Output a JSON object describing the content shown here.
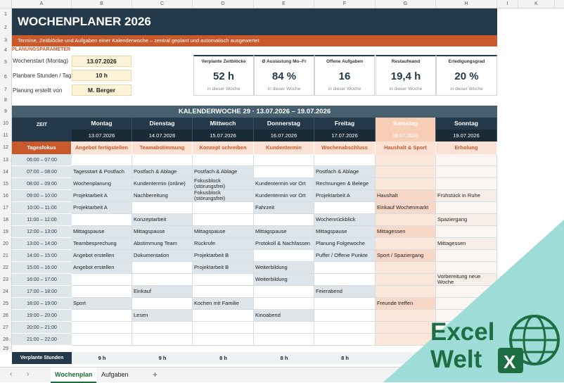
{
  "columns": [
    "A",
    "B",
    "C",
    "D",
    "E",
    "F",
    "G",
    "H",
    "I",
    "K"
  ],
  "rows": [
    "1",
    "2",
    "3",
    "4",
    "5",
    "6",
    "7",
    "8",
    "9",
    "10",
    "11",
    "12",
    "13",
    "14",
    "15",
    "16",
    "17",
    "18",
    "19",
    "20",
    "21",
    "22",
    "23",
    "24",
    "25",
    "26",
    "27",
    "28",
    "29"
  ],
  "title": "WOCHENPLANER 2026",
  "subtitle": "Termine, Zeitblöcke und Aufgaben einer Kalenderwoche – zentral geplant und automatisch ausgewertet",
  "params": {
    "header": "PLANUNGSPARAMETER",
    "items": [
      {
        "label": "Wochenstart (Montag)",
        "value": "13.07.2026"
      },
      {
        "label": "Planbare Stunden / Tag",
        "value": "10 h"
      },
      {
        "label": "Planung erstellt von",
        "value": "M. Berger"
      }
    ]
  },
  "kpis": [
    {
      "label": "Verplante Zeitblöcke",
      "value": "52 h",
      "sub": "in dieser Woche"
    },
    {
      "label": "Ø Auslastung Mo–Fr",
      "value": "84 %",
      "sub": "in dieser Woche"
    },
    {
      "label": "Offene Aufgaben",
      "value": "16",
      "sub": "in dieser Woche"
    },
    {
      "label": "Restaufwand",
      "value": "19,4 h",
      "sub": "in dieser Woche"
    },
    {
      "label": "Erledigungsgrad",
      "value": "20 %",
      "sub": "in dieser Woche"
    }
  ],
  "kw_title": "KALENDERWOCHE 29   ·   13.07.2026 – 19.07.2026",
  "zeit_label": "ZEIT",
  "days": [
    {
      "name": "Montag",
      "date": "13.07.2026",
      "focus": "Angebot fertigstellen"
    },
    {
      "name": "Dienstag",
      "date": "14.07.2026",
      "focus": "Teamabstimmung"
    },
    {
      "name": "Mittwoch",
      "date": "15.07.2026",
      "focus": "Konzept schreiben"
    },
    {
      "name": "Donnerstag",
      "date": "16.07.2026",
      "focus": "Kundentermin"
    },
    {
      "name": "Freitag",
      "date": "17.07.2026",
      "focus": "Wochenabschluss"
    },
    {
      "name": "Samstag",
      "date": "18.07.2026",
      "focus": "Haushalt & Sport"
    },
    {
      "name": "Sonntag",
      "date": "19.07.2026",
      "focus": "Erholung"
    }
  ],
  "focus_label": "Tagesfokus",
  "slots": [
    {
      "time": "06:00 – 07:00",
      "cells": [
        "",
        "",
        "",
        "",
        "",
        "",
        ""
      ]
    },
    {
      "time": "07:00 – 08:00",
      "cells": [
        "Tagesstart & Postfach",
        "Postfach & Ablage",
        "Postfach & Ablage",
        "",
        "Postfach & Ablage",
        "",
        ""
      ]
    },
    {
      "time": "08:00 – 09:00",
      "cells": [
        "Wochenplanung",
        "Kundentermin (online)",
        "Fokusblock (störungsfrei)",
        "Kundentermin vor Ort",
        "Rechnungen & Belege",
        "",
        ""
      ]
    },
    {
      "time": "09:00 – 10:00",
      "cells": [
        "Projektarbeit A",
        "Nachbereitung",
        "Fokusblock (störungsfrei)",
        "Kundentermin vor Ort",
        "Projektarbeit A",
        "Haushalt",
        "Frühstück in Ruhe"
      ]
    },
    {
      "time": "10:00 – 11:00",
      "cells": [
        "Projektarbeit A",
        "",
        "",
        "Fahrzeit",
        "",
        "Einkauf Wochenmarkt",
        ""
      ]
    },
    {
      "time": "11:00 – 12:00",
      "cells": [
        "",
        "Konzeptarbeit",
        "",
        "",
        "Wochenrückblick",
        "",
        "Spaziergang"
      ]
    },
    {
      "time": "12:00 – 13:00",
      "cells": [
        "Mittagspause",
        "Mittagspause",
        "Mittagspause",
        "Mittagspause",
        "Mittagspause",
        "Mittagessen",
        ""
      ]
    },
    {
      "time": "13:00 – 14:00",
      "cells": [
        "Teambesprechung",
        "Abstimmung Team",
        "Rückrufe",
        "Protokoll & Nachfassen",
        "Planung Folgewoche",
        "",
        "Mittagessen"
      ]
    },
    {
      "time": "14:00 – 15:00",
      "cells": [
        "Angebot erstellen",
        "Dokumentation",
        "Projektarbeit B",
        "",
        "Puffer / Offene Punkte",
        "Sport / Spaziergang",
        ""
      ]
    },
    {
      "time": "15:00 – 16:00",
      "cells": [
        "Angebot erstellen",
        "",
        "Projektarbeit B",
        "Weiterbildung",
        "",
        "",
        ""
      ]
    },
    {
      "time": "16:00 – 17:00",
      "cells": [
        "",
        "",
        "",
        "Weiterbildung",
        "",
        "",
        "Vorbereitung neue Woche"
      ]
    },
    {
      "time": "17:00 – 18:00",
      "cells": [
        "",
        "Einkauf",
        "",
        "",
        "Feierabend",
        "",
        ""
      ]
    },
    {
      "time": "18:00 – 19:00",
      "cells": [
        "Sport",
        "",
        "Kochen mit Familie",
        "",
        "",
        "Freunde treffen",
        ""
      ]
    },
    {
      "time": "19:00 – 20:00",
      "cells": [
        "",
        "Lesen",
        "",
        "Kinoabend",
        "",
        "",
        ""
      ]
    },
    {
      "time": "20:00 – 21:00",
      "cells": [
        "",
        "",
        "",
        "",
        "",
        "",
        ""
      ]
    },
    {
      "time": "21:00 – 22:00",
      "cells": [
        "",
        "",
        "",
        "",
        "",
        "",
        ""
      ]
    }
  ],
  "sum_label": "Verplante Stunden",
  "sums": [
    "9 h",
    "9 h",
    "8 h",
    "8 h",
    "8 h",
    "",
    ""
  ],
  "sheet_tabs": [
    {
      "label": "Wochenplan",
      "active": true
    },
    {
      "label": "Aufgaben",
      "active": false
    }
  ],
  "logo": {
    "line1": "Excel",
    "line2": "Welt",
    "badge": "X",
    "color": "#1e6e44",
    "bg": "#9ddcd7"
  },
  "colors": {
    "navy": "#243a4b",
    "orange": "#c9582a",
    "cream": "#fdf3d8"
  }
}
